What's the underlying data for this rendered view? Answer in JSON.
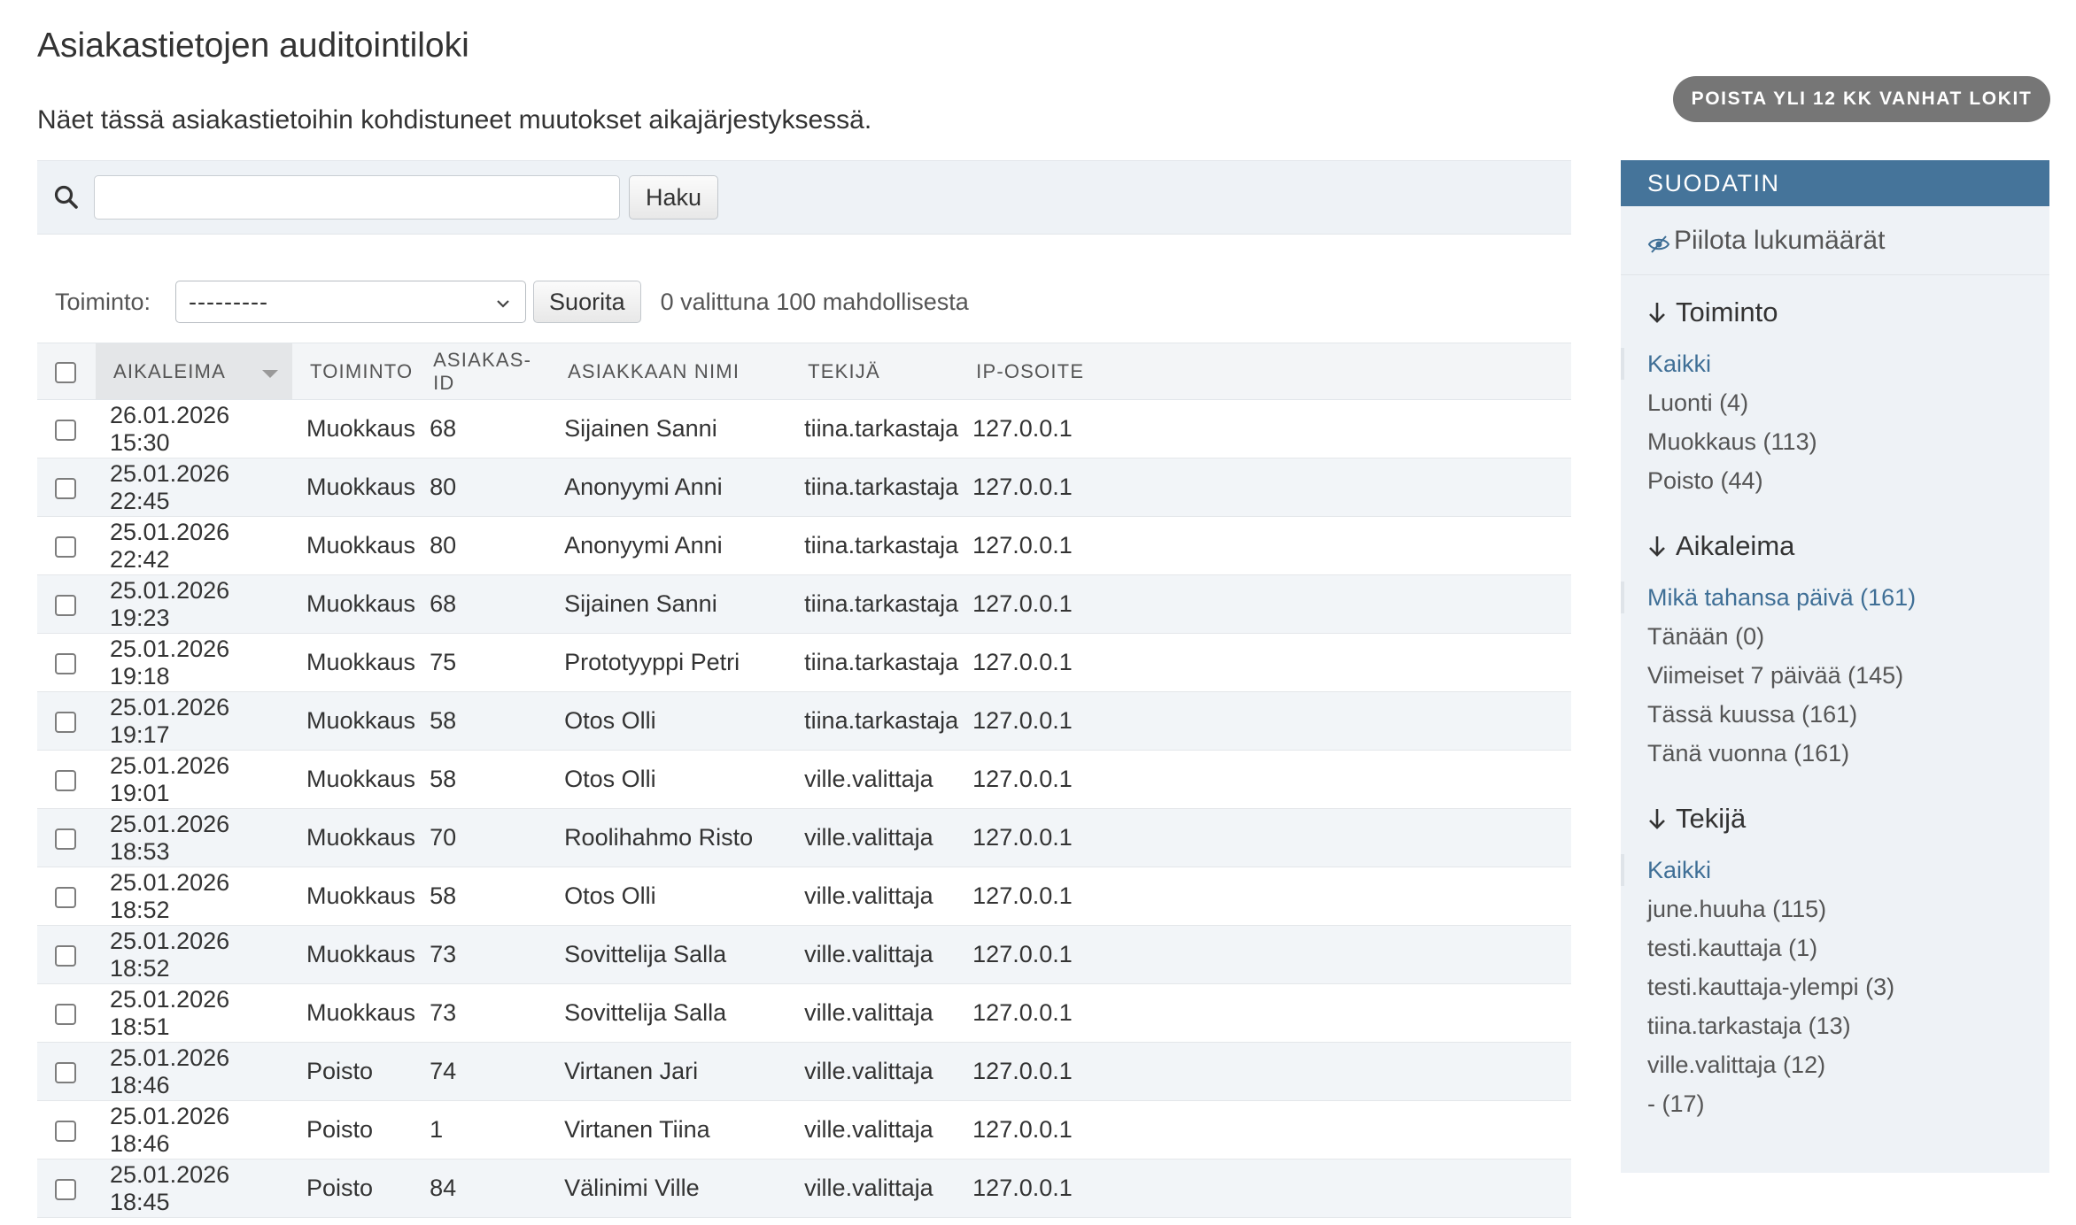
{
  "page": {
    "title": "Asiakastietojen auditointiloki",
    "subtitle": "Näet tässä asiakastietoihin kohdistuneet muutokset aikajärjestyksessä.",
    "purge_button": "POISTA YLI 12 KK VANHAT LOKIT"
  },
  "search": {
    "value": "",
    "placeholder": "",
    "button": "Haku"
  },
  "actions": {
    "label": "Toiminto:",
    "selected": "---------",
    "go_button": "Suorita",
    "selection_count": "0 valittuna 100 mahdollisesta"
  },
  "table": {
    "columns": [
      "Aikaleima",
      "Toiminto",
      "Asiakas-ID",
      "Asiakkaan nimi",
      "Tekijä",
      "IP-osoite"
    ],
    "rows": [
      [
        "26.01.2026 15:30",
        "Muokkaus",
        "68",
        "Sijainen Sanni",
        "tiina.tarkastaja",
        "127.0.0.1"
      ],
      [
        "25.01.2026 22:45",
        "Muokkaus",
        "80",
        "Anonyymi Anni",
        "tiina.tarkastaja",
        "127.0.0.1"
      ],
      [
        "25.01.2026 22:42",
        "Muokkaus",
        "80",
        "Anonyymi Anni",
        "tiina.tarkastaja",
        "127.0.0.1"
      ],
      [
        "25.01.2026 19:23",
        "Muokkaus",
        "68",
        "Sijainen Sanni",
        "tiina.tarkastaja",
        "127.0.0.1"
      ],
      [
        "25.01.2026 19:18",
        "Muokkaus",
        "75",
        "Prototyyppi Petri",
        "tiina.tarkastaja",
        "127.0.0.1"
      ],
      [
        "25.01.2026 19:17",
        "Muokkaus",
        "58",
        "Otos Olli",
        "tiina.tarkastaja",
        "127.0.0.1"
      ],
      [
        "25.01.2026 19:01",
        "Muokkaus",
        "58",
        "Otos Olli",
        "ville.valittaja",
        "127.0.0.1"
      ],
      [
        "25.01.2026 18:53",
        "Muokkaus",
        "70",
        "Roolihahmo Risto",
        "ville.valittaja",
        "127.0.0.1"
      ],
      [
        "25.01.2026 18:52",
        "Muokkaus",
        "58",
        "Otos Olli",
        "ville.valittaja",
        "127.0.0.1"
      ],
      [
        "25.01.2026 18:52",
        "Muokkaus",
        "73",
        "Sovittelija Salla",
        "ville.valittaja",
        "127.0.0.1"
      ],
      [
        "25.01.2026 18:51",
        "Muokkaus",
        "73",
        "Sovittelija Salla",
        "ville.valittaja",
        "127.0.0.1"
      ],
      [
        "25.01.2026 18:46",
        "Poisto",
        "74",
        "Virtanen Jari",
        "ville.valittaja",
        "127.0.0.1"
      ],
      [
        "25.01.2026 18:46",
        "Poisto",
        "1",
        "Virtanen Tiina",
        "ville.valittaja",
        "127.0.0.1"
      ],
      [
        "25.01.2026 18:45",
        "Poisto",
        "84",
        "Välinimi Ville",
        "ville.valittaja",
        "127.0.0.1"
      ]
    ]
  },
  "filter": {
    "title": "SUODATIN",
    "hide_counts": "Piilota lukumäärät",
    "groups": [
      {
        "title": "Toiminto",
        "items": [
          "Kaikki",
          "Luonti (4)",
          "Muokkaus (113)",
          "Poisto (44)"
        ],
        "selected_index": 0
      },
      {
        "title": "Aikaleima",
        "items": [
          "Mikä tahansa päivä (161)",
          "Tänään (0)",
          "Viimeiset 7 päivää (145)",
          "Tässä kuussa (161)",
          "Tänä vuonna (161)"
        ],
        "selected_index": 0
      },
      {
        "title": "Tekijä",
        "items": [
          "Kaikki",
          "june.huuha (115)",
          "testi.kauttaja (1)",
          "testi.kauttaja-ylempi (3)",
          "tiina.tarkastaja (13)",
          "ville.valittaja (12)",
          "- (17)"
        ],
        "selected_index": 0
      }
    ]
  },
  "colors": {
    "filter_header": "#45749a",
    "link": "#3f6f96",
    "purge_button": "#767676"
  },
  "icons": {
    "search": "search-icon",
    "eye": "eye-slash-icon",
    "filter_arrow": "arrow-down-icon",
    "select_chevron": "chevron-down-icon"
  }
}
